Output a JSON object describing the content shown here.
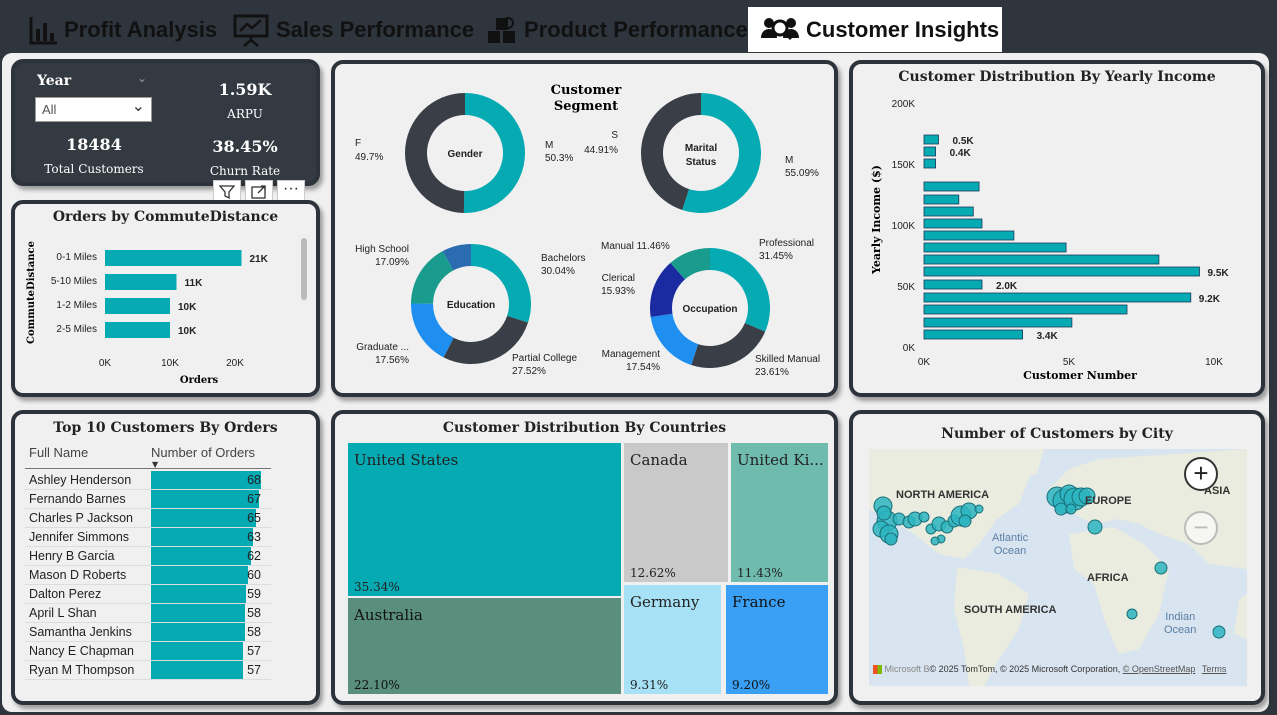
{
  "tabs": [
    {
      "label": "Profit Analysis",
      "icon": "bar-chart-icon"
    },
    {
      "label": "Sales Performance",
      "icon": "presentation-icon"
    },
    {
      "label": "Product Performance",
      "icon": "boxes-icon"
    },
    {
      "label": "Customer Insights",
      "icon": "people-search-icon"
    }
  ],
  "kpis": {
    "year_label": "Year",
    "year_value": "All",
    "arpu_value": "1.59K",
    "arpu_label": "ARPU",
    "customers_value": "18484",
    "customers_label": "Total Customers",
    "churn_value": "38.45%",
    "churn_label": "Churn Rate"
  },
  "commute": {
    "title": "Orders by CommuteDistance",
    "ylabel": "CommuteDistance",
    "xlabel": "Orders",
    "bars": [
      {
        "label": "0-1 Miles",
        "value": 21,
        "text": "21K"
      },
      {
        "label": "5-10 Miles",
        "value": 11,
        "text": "11K"
      },
      {
        "label": "1-2 Miles",
        "value": 10,
        "text": "10K"
      },
      {
        "label": "2-5 Miles",
        "value": 10,
        "text": "10K"
      }
    ],
    "ticks": [
      "0K",
      "10K",
      "20K"
    ]
  },
  "segment": {
    "title1": "Customer",
    "title2": "Segment",
    "gender": {
      "center": "Gender",
      "left_label": "F",
      "left_pct": "49.7%",
      "right_label": "M",
      "right_pct": "50.3%"
    },
    "marital": {
      "center1": "Marital",
      "center2": "Status",
      "left_label": "S",
      "left_pct": "44.91%",
      "right_label": "M",
      "right_pct": "55.09%"
    },
    "education": {
      "center": "Education",
      "items": [
        {
          "label": "Bachelors",
          "pct": "30.04%"
        },
        {
          "label": "Partial College",
          "pct": "27.52%"
        },
        {
          "label": "Graduate ...",
          "pct": "17.56%"
        },
        {
          "label": "High School",
          "pct": "17.09%"
        }
      ]
    },
    "occupation": {
      "center": "Occupation",
      "items": [
        {
          "label": "Professional",
          "pct": "31.45%"
        },
        {
          "label": "Skilled Manual",
          "pct": "23.61%"
        },
        {
          "label": "Management",
          "pct": "17.54%"
        },
        {
          "label": "Clerical",
          "pct": "15.93%"
        },
        {
          "label": "Manual",
          "pct": "11.46%"
        }
      ]
    }
  },
  "income": {
    "title": "Customer Distribution By Yearly Income",
    "ylabel": "Yearly Income ($)",
    "xlabel": "Customer Number",
    "yticks": [
      "200K",
      "150K",
      "100K",
      "50K",
      "0K"
    ],
    "xticks": [
      "0K",
      "5K",
      "10K"
    ],
    "bars": [
      {
        "k": "0.5K"
      },
      {
        "k": "0.4K"
      },
      {
        "k": ""
      },
      {
        "k": ""
      },
      {
        "k": ""
      },
      {
        "k": ""
      },
      {
        "k": ""
      },
      {
        "k": ""
      },
      {
        "k": ""
      },
      {
        "k": "9.5K"
      },
      {
        "k": "2.0K"
      },
      {
        "k": "9.2K"
      },
      {
        "k": ""
      },
      {
        "k": ""
      },
      {
        "k": "3.4K"
      }
    ]
  },
  "top10": {
    "title": "Top 10 Customers By Orders",
    "col1": "Full Name",
    "col2": "Number of Orders",
    "rows": [
      {
        "name": "Ashley Henderson",
        "orders": "68",
        "v": 68
      },
      {
        "name": "Fernando Barnes",
        "orders": "67",
        "v": 67
      },
      {
        "name": "Charles P Jackson",
        "orders": "65",
        "v": 65
      },
      {
        "name": "Jennifer Simmons",
        "orders": "63",
        "v": 63
      },
      {
        "name": "Henry B Garcia",
        "orders": "62",
        "v": 62
      },
      {
        "name": "Mason D Roberts",
        "orders": "60",
        "v": 60
      },
      {
        "name": "Dalton Perez",
        "orders": "59",
        "v": 59
      },
      {
        "name": "April L Shan",
        "orders": "58",
        "v": 58
      },
      {
        "name": "Samantha Jenkins",
        "orders": "58",
        "v": 58
      },
      {
        "name": "Nancy E Chapman",
        "orders": "57",
        "v": 57
      },
      {
        "name": "Ryan M Thompson",
        "orders": "57",
        "v": 57
      }
    ]
  },
  "countries": {
    "title": "Customer Distribution By Countries",
    "cells": [
      {
        "name": "United States",
        "pct": "35.34%"
      },
      {
        "name": "Canada",
        "pct": "12.62%"
      },
      {
        "name": "United Ki...",
        "pct": "11.43%"
      },
      {
        "name": "Australia",
        "pct": "22.10%"
      },
      {
        "name": "Germany",
        "pct": "9.31%"
      },
      {
        "name": "France",
        "pct": "9.20%"
      }
    ]
  },
  "map": {
    "title": "Number of Customers by City",
    "labels": {
      "na": "NORTH AMERICA",
      "eu": "EUROPE",
      "asia": "ASIA",
      "africa": "AFRICA",
      "sa": "SOUTH AMERICA",
      "atl1": "Atlantic",
      "atl2": "Ocean",
      "ind1": "Indian",
      "ind2": "Ocean"
    },
    "attribution": "© 2025 TomTom, © 2025 Microsoft Corporation,",
    "osm": "© OpenStreetMap",
    "terms": "Terms",
    "brand": "Microsoft B"
  },
  "colors": {
    "teal": "#05aab3",
    "dark": "#3a3f47",
    "navy": "#1a2aa0",
    "blue": "#1e8ff0",
    "green": "#199b8e"
  }
}
